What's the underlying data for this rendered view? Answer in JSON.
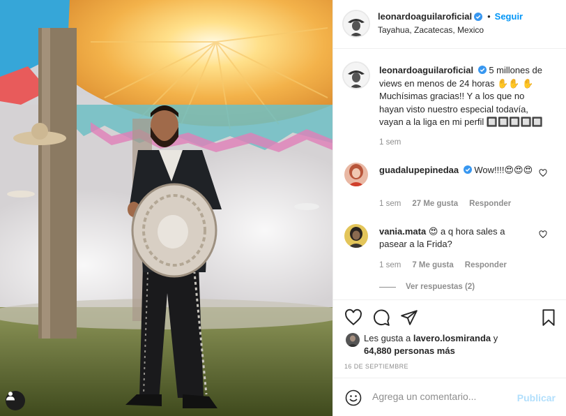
{
  "post": {
    "author": "leonardoaguilaroficial",
    "follow_separator": "•",
    "follow_label": "Seguir",
    "location": "Tayahua, Zacatecas, Mexico",
    "caption": "5 millones de views en menos de 24 horas ✋✋ ✋ Muchísimas gracias!! Y a los que no hayan visto nuestro especial todavía, vayan a la liga en mi perfil 🔲🔲🔲🔲🔲",
    "caption_time": "1 sem"
  },
  "comments": [
    {
      "user": "guadalupepinedaa",
      "verified": true,
      "text": "Wow!!!!😍😍😍",
      "time": "1 sem",
      "likes": "27 Me gusta",
      "reply": "Responder"
    },
    {
      "user": "vania.mata",
      "verified": false,
      "text": "😍 a q hora sales a pasear a la Frida?",
      "time": "1 sem",
      "likes": "7 Me gusta",
      "reply": "Responder"
    }
  ],
  "view_replies": "Ver respuestas (2)",
  "likes_line": {
    "prefix": "Les gusta a",
    "user": "lavero.losmiranda",
    "connector": "y",
    "others": "64,880 personas más"
  },
  "date": "16 DE SEPTIEMBRE",
  "add_comment": {
    "placeholder": "Agrega un comentario...",
    "publish_label": "Publicar"
  },
  "colors": {
    "accent": "#0095f6",
    "publish_disabled": "#b2dffc",
    "verified": "#3897f0",
    "muted": "#8e8e8e"
  },
  "icons": [
    "user-tag-icon",
    "verified-badge-icon",
    "heart-icon",
    "comment-icon",
    "share-icon",
    "bookmark-icon",
    "emoji-icon"
  ]
}
